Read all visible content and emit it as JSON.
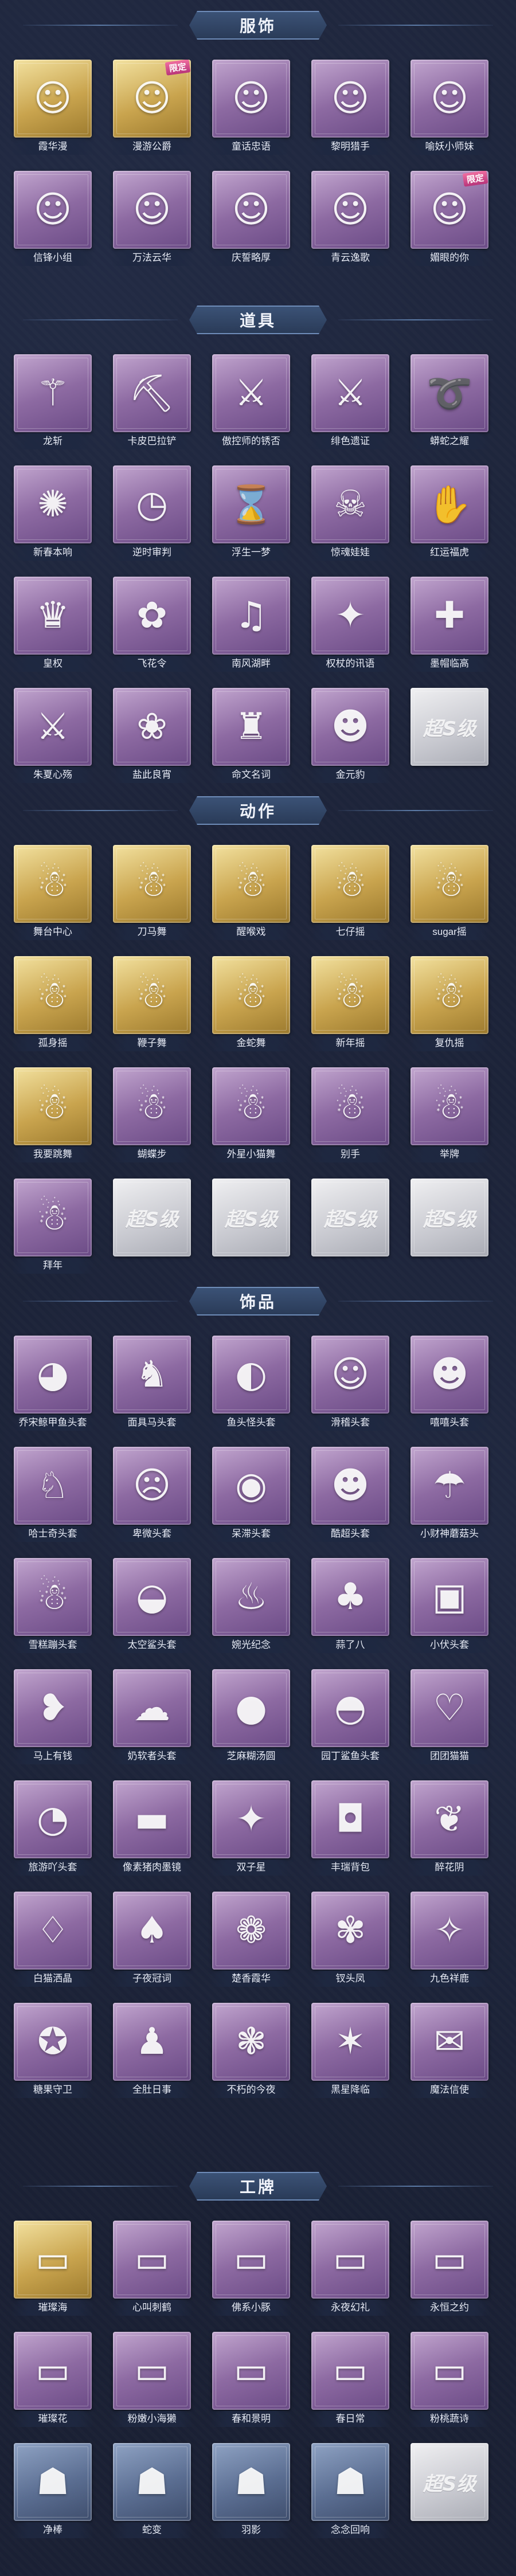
{
  "colors": {
    "background": "#1a2034",
    "purple_card": "#8d6aa2",
    "gold_card": "#c9a44e",
    "white_card": "#c7c8cf",
    "header_plate": "#3b5276"
  },
  "sections": [
    {
      "title": "服饰",
      "items": [
        {
          "label": "霞华漫",
          "tier": "gold",
          "icon": "character-portrait-icon",
          "glyph": "☺",
          "badge": ""
        },
        {
          "label": "漫游公爵",
          "tier": "gold",
          "icon": "character-portrait-icon",
          "glyph": "☺",
          "badge": "限定"
        },
        {
          "label": "童话忠语",
          "tier": "purple",
          "icon": "character-portrait-icon",
          "glyph": "☺",
          "badge": ""
        },
        {
          "label": "黎明猎手",
          "tier": "purple",
          "icon": "character-portrait-icon",
          "glyph": "☺",
          "badge": ""
        },
        {
          "label": "喻妖小师妹",
          "tier": "purple",
          "icon": "character-portrait-icon",
          "glyph": "☺",
          "badge": ""
        },
        {
          "label": "信锋小组",
          "tier": "purple",
          "icon": "character-portrait-icon",
          "glyph": "☺",
          "badge": ""
        },
        {
          "label": "万法云华",
          "tier": "purple",
          "icon": "character-portrait-icon",
          "glyph": "☺",
          "badge": ""
        },
        {
          "label": "庆誓略厚",
          "tier": "purple",
          "icon": "character-portrait-icon",
          "glyph": "☺",
          "badge": ""
        },
        {
          "label": "青云逸歌",
          "tier": "purple",
          "icon": "character-portrait-icon",
          "glyph": "☺",
          "badge": ""
        },
        {
          "label": "媚眼的你",
          "tier": "purple",
          "icon": "character-portrait-icon",
          "glyph": "☺",
          "badge": "限定"
        }
      ]
    },
    {
      "title": "道具",
      "items": [
        {
          "label": "龙斩",
          "tier": "purple",
          "icon": "golden-staff-icon",
          "glyph": "⚚",
          "badge": ""
        },
        {
          "label": "卡皮巴拉铲",
          "tier": "purple",
          "icon": "capybara-shovel-icon",
          "glyph": "⛏",
          "badge": ""
        },
        {
          "label": "傲控师的锈否",
          "tier": "purple",
          "icon": "trident-icon",
          "glyph": "⚔",
          "badge": ""
        },
        {
          "label": "绯色遗证",
          "tier": "purple",
          "icon": "red-sword-icon",
          "glyph": "⚔",
          "badge": ""
        },
        {
          "label": "蟒蛇之耀",
          "tier": "purple",
          "icon": "whip-icon",
          "glyph": "➰",
          "badge": ""
        },
        {
          "label": "新春本响",
          "tier": "purple",
          "icon": "firecracker-icon",
          "glyph": "✺",
          "badge": ""
        },
        {
          "label": "逆时审判",
          "tier": "purple",
          "icon": "clock-icon",
          "glyph": "◷",
          "badge": ""
        },
        {
          "label": "浮生一梦",
          "tier": "purple",
          "icon": "hourglass-icon",
          "glyph": "⌛",
          "badge": ""
        },
        {
          "label": "惊魂娃娃",
          "tier": "purple",
          "icon": "skull-doll-icon",
          "glyph": "☠",
          "badge": ""
        },
        {
          "label": "红运福虎",
          "tier": "purple",
          "icon": "tiger-icon",
          "glyph": "✋",
          "badge": ""
        },
        {
          "label": "皇权",
          "tier": "purple",
          "icon": "scepter-icon",
          "glyph": "♛",
          "badge": ""
        },
        {
          "label": "飞花令",
          "tier": "purple",
          "icon": "flower-fan-icon",
          "glyph": "✿",
          "badge": ""
        },
        {
          "label": "南风湖畔",
          "tier": "purple",
          "icon": "speaker-icon",
          "glyph": "♫",
          "badge": ""
        },
        {
          "label": "权杖的讯语",
          "tier": "purple",
          "icon": "scepter-icon",
          "glyph": "✦",
          "badge": ""
        },
        {
          "label": "墨帽临高",
          "tier": "purple",
          "icon": "medkit-icon",
          "glyph": "✚",
          "badge": ""
        },
        {
          "label": "朱夏心殇",
          "tier": "purple",
          "icon": "sword-icon",
          "glyph": "⚔",
          "badge": ""
        },
        {
          "label": "盐此良宵",
          "tier": "purple",
          "icon": "lotus-lamp-icon",
          "glyph": "❀",
          "badge": ""
        },
        {
          "label": "命文名词",
          "tier": "purple",
          "icon": "grenade-icon",
          "glyph": "♜",
          "badge": ""
        },
        {
          "label": "金元豹",
          "tier": "purple",
          "icon": "lucky-cat-icon",
          "glyph": "☻",
          "badge": ""
        },
        {
          "label": "",
          "tier": "white",
          "icon": "locked-placeholder-icon",
          "glyph": "超S级",
          "badge": ""
        }
      ]
    },
    {
      "title": "动作",
      "items": [
        {
          "label": "舞台中心",
          "tier": "gold",
          "icon": "dance-pose-icon",
          "glyph": "☃",
          "badge": ""
        },
        {
          "label": "刀马舞",
          "tier": "gold",
          "icon": "dance-pose-icon",
          "glyph": "☃",
          "badge": ""
        },
        {
          "label": "醒喉戏",
          "tier": "gold",
          "icon": "dance-pose-icon",
          "glyph": "☃",
          "badge": ""
        },
        {
          "label": "七仔摇",
          "tier": "gold",
          "icon": "dance-pose-icon",
          "glyph": "☃",
          "badge": ""
        },
        {
          "label": "sugar摇",
          "tier": "gold",
          "icon": "dance-pose-icon",
          "glyph": "☃",
          "badge": ""
        },
        {
          "label": "孤身摇",
          "tier": "gold",
          "icon": "dance-pose-icon",
          "glyph": "☃",
          "badge": ""
        },
        {
          "label": "鞭子舞",
          "tier": "gold",
          "icon": "dance-pose-icon",
          "glyph": "☃",
          "badge": ""
        },
        {
          "label": "金蛇舞",
          "tier": "gold",
          "icon": "dance-pose-icon",
          "glyph": "☃",
          "badge": ""
        },
        {
          "label": "新年摇",
          "tier": "gold",
          "icon": "dance-pose-icon",
          "glyph": "☃",
          "badge": ""
        },
        {
          "label": "复仇摇",
          "tier": "gold",
          "icon": "dance-pose-icon",
          "glyph": "☃",
          "badge": ""
        },
        {
          "label": "我要跳舞",
          "tier": "gold",
          "icon": "dance-pose-icon",
          "glyph": "☃",
          "badge": ""
        },
        {
          "label": "蝴蝶步",
          "tier": "purple",
          "icon": "dance-pose-icon",
          "glyph": "☃",
          "badge": ""
        },
        {
          "label": "外星小猫舞",
          "tier": "purple",
          "icon": "dance-pose-icon",
          "glyph": "☃",
          "badge": ""
        },
        {
          "label": "别手",
          "tier": "purple",
          "icon": "dance-pose-icon",
          "glyph": "☃",
          "badge": ""
        },
        {
          "label": "举牌",
          "tier": "purple",
          "icon": "dance-pose-icon",
          "glyph": "☃",
          "badge": ""
        },
        {
          "label": "拜年",
          "tier": "purple",
          "icon": "dance-pose-icon",
          "glyph": "☃",
          "badge": ""
        },
        {
          "label": "",
          "tier": "white",
          "icon": "locked-placeholder-icon",
          "glyph": "超S级",
          "badge": ""
        },
        {
          "label": "",
          "tier": "white",
          "icon": "locked-placeholder-icon",
          "glyph": "超S级",
          "badge": ""
        },
        {
          "label": "",
          "tier": "white",
          "icon": "locked-placeholder-icon",
          "glyph": "超S级",
          "badge": ""
        },
        {
          "label": "",
          "tier": "white",
          "icon": "locked-placeholder-icon",
          "glyph": "超S级",
          "badge": ""
        }
      ]
    },
    {
      "title": "饰品",
      "items": [
        {
          "label": "乔宋鲸甲鱼头套",
          "tier": "purple",
          "icon": "penguin-head-icon",
          "glyph": "◕",
          "badge": ""
        },
        {
          "label": "面具马头套",
          "tier": "purple",
          "icon": "horse-head-icon",
          "glyph": "♞",
          "badge": ""
        },
        {
          "label": "鱼头怪头套",
          "tier": "purple",
          "icon": "fish-head-icon",
          "glyph": "◐",
          "badge": ""
        },
        {
          "label": "滑稽头套",
          "tier": "purple",
          "icon": "smiley-head-icon",
          "glyph": "☺",
          "badge": ""
        },
        {
          "label": "嘻嘻头套",
          "tier": "purple",
          "icon": "grin-head-icon",
          "glyph": "☻",
          "badge": ""
        },
        {
          "label": "哈士奇头套",
          "tier": "purple",
          "icon": "husky-head-icon",
          "glyph": "♘",
          "badge": ""
        },
        {
          "label": "卑微头套",
          "tier": "purple",
          "icon": "sad-face-icon",
          "glyph": "☹",
          "badge": ""
        },
        {
          "label": "呆滞头套",
          "tier": "purple",
          "icon": "stare-face-icon",
          "glyph": "◉",
          "badge": ""
        },
        {
          "label": "酷超头套",
          "tier": "purple",
          "icon": "cool-face-icon",
          "glyph": "☻",
          "badge": ""
        },
        {
          "label": "小财神蘑菇头",
          "tier": "purple",
          "icon": "mushroom-head-icon",
          "glyph": "☂",
          "badge": ""
        },
        {
          "label": "雪糕蹦头套",
          "tier": "purple",
          "icon": "snowman-head-icon",
          "glyph": "☃",
          "badge": ""
        },
        {
          "label": "太空鲨头套",
          "tier": "purple",
          "icon": "shark-head-icon",
          "glyph": "◒",
          "badge": ""
        },
        {
          "label": "婉光纪念",
          "tier": "purple",
          "icon": "candle-head-icon",
          "glyph": "♨",
          "badge": ""
        },
        {
          "label": "蒜了八",
          "tier": "purple",
          "icon": "garlic-head-icon",
          "glyph": "♣",
          "badge": ""
        },
        {
          "label": "小伏头套",
          "tier": "purple",
          "icon": "tv-head-icon",
          "glyph": "▣",
          "badge": ""
        },
        {
          "label": "马上有钱",
          "tier": "purple",
          "icon": "bird-head-icon",
          "glyph": "❥",
          "badge": ""
        },
        {
          "label": "奶软者头套",
          "tier": "purple",
          "icon": "cloud-head-icon",
          "glyph": "☁",
          "badge": ""
        },
        {
          "label": "芝麻糊汤圆",
          "tier": "purple",
          "icon": "dumpling-head-icon",
          "glyph": "●",
          "badge": ""
        },
        {
          "label": "园丁鲨鱼头套",
          "tier": "purple",
          "icon": "shark-head-icon",
          "glyph": "◓",
          "badge": ""
        },
        {
          "label": "团团猫猫",
          "tier": "purple",
          "icon": "cat-head-icon",
          "glyph": "♡",
          "badge": ""
        },
        {
          "label": "旅游吖头套",
          "tier": "purple",
          "icon": "duck-head-icon",
          "glyph": "◔",
          "badge": ""
        },
        {
          "label": "像素猪肉墨镜",
          "tier": "purple",
          "icon": "pixel-sunglasses-icon",
          "glyph": "▬",
          "badge": ""
        },
        {
          "label": "双子星",
          "tier": "purple",
          "icon": "twin-star-icon",
          "glyph": "✦",
          "badge": ""
        },
        {
          "label": "丰瑞背包",
          "tier": "purple",
          "icon": "backpack-icon",
          "glyph": "◘",
          "badge": ""
        },
        {
          "label": "醉花阴",
          "tier": "purple",
          "icon": "lantern-icon",
          "glyph": "❦",
          "badge": ""
        },
        {
          "label": "白猫洒晶",
          "tier": "purple",
          "icon": "cat-charm-icon",
          "glyph": "♢",
          "badge": ""
        },
        {
          "label": "子夜冠词",
          "tier": "purple",
          "icon": "figure-charm-icon",
          "glyph": "♠",
          "badge": ""
        },
        {
          "label": "楚香霞华",
          "tier": "purple",
          "icon": "figure-charm-icon",
          "glyph": "❁",
          "badge": ""
        },
        {
          "label": "钗头凤",
          "tier": "purple",
          "icon": "figure-charm-icon",
          "glyph": "✾",
          "badge": ""
        },
        {
          "label": "九色祥鹿",
          "tier": "purple",
          "icon": "deer-charm-icon",
          "glyph": "✧",
          "badge": ""
        },
        {
          "label": "糖果守卫",
          "tier": "purple",
          "icon": "candy-charm-icon",
          "glyph": "✪",
          "badge": ""
        },
        {
          "label": "全肚日事",
          "tier": "purple",
          "icon": "figure-charm-icon",
          "glyph": "♟",
          "badge": ""
        },
        {
          "label": "不朽的今夜",
          "tier": "purple",
          "icon": "doll-charm-icon",
          "glyph": "❃",
          "badge": ""
        },
        {
          "label": "黑星降临",
          "tier": "purple",
          "icon": "figure-charm-icon",
          "glyph": "✶",
          "badge": ""
        },
        {
          "label": "魔法信使",
          "tier": "purple",
          "icon": "mouse-charm-icon",
          "glyph": "✉",
          "badge": ""
        }
      ]
    },
    {
      "title": "工牌",
      "items": [
        {
          "label": "璀璨海",
          "tier": "gold",
          "icon": "badge-frame-icon",
          "glyph": "▭",
          "badge": ""
        },
        {
          "label": "心叫刺鹤",
          "tier": "purple",
          "icon": "badge-frame-icon",
          "glyph": "▭",
          "badge": ""
        },
        {
          "label": "佛系小豚",
          "tier": "purple",
          "icon": "badge-frame-icon",
          "glyph": "▭",
          "badge": ""
        },
        {
          "label": "永夜幻礼",
          "tier": "purple",
          "icon": "badge-frame-icon",
          "glyph": "▭",
          "badge": ""
        },
        {
          "label": "永恒之约",
          "tier": "purple",
          "icon": "badge-frame-icon",
          "glyph": "▭",
          "badge": ""
        },
        {
          "label": "璀璨花",
          "tier": "purple",
          "icon": "badge-frame-icon",
          "glyph": "▭",
          "badge": ""
        },
        {
          "label": "粉嫩小海獭",
          "tier": "purple",
          "icon": "badge-frame-icon",
          "glyph": "▭",
          "badge": ""
        },
        {
          "label": "春和景明",
          "tier": "purple",
          "icon": "badge-frame-icon",
          "glyph": "▭",
          "badge": ""
        },
        {
          "label": "春日常",
          "tier": "purple",
          "icon": "badge-frame-icon",
          "glyph": "▭",
          "badge": ""
        },
        {
          "label": "粉桃蔬诗",
          "tier": "purple",
          "icon": "badge-frame-icon",
          "glyph": "▭",
          "badge": ""
        },
        {
          "label": "净棒",
          "tier": "blue",
          "icon": "silhouette-badge-icon",
          "glyph": "☗",
          "badge": ""
        },
        {
          "label": "蛇变",
          "tier": "blue",
          "icon": "silhouette-badge-icon",
          "glyph": "☗",
          "badge": ""
        },
        {
          "label": "羽影",
          "tier": "blue",
          "icon": "silhouette-badge-icon",
          "glyph": "☗",
          "badge": ""
        },
        {
          "label": "念念回响",
          "tier": "blue",
          "icon": "silhouette-badge-icon",
          "glyph": "☗",
          "badge": ""
        },
        {
          "label": "",
          "tier": "white",
          "icon": "locked-placeholder-icon",
          "glyph": "超S级",
          "badge": ""
        }
      ]
    }
  ]
}
